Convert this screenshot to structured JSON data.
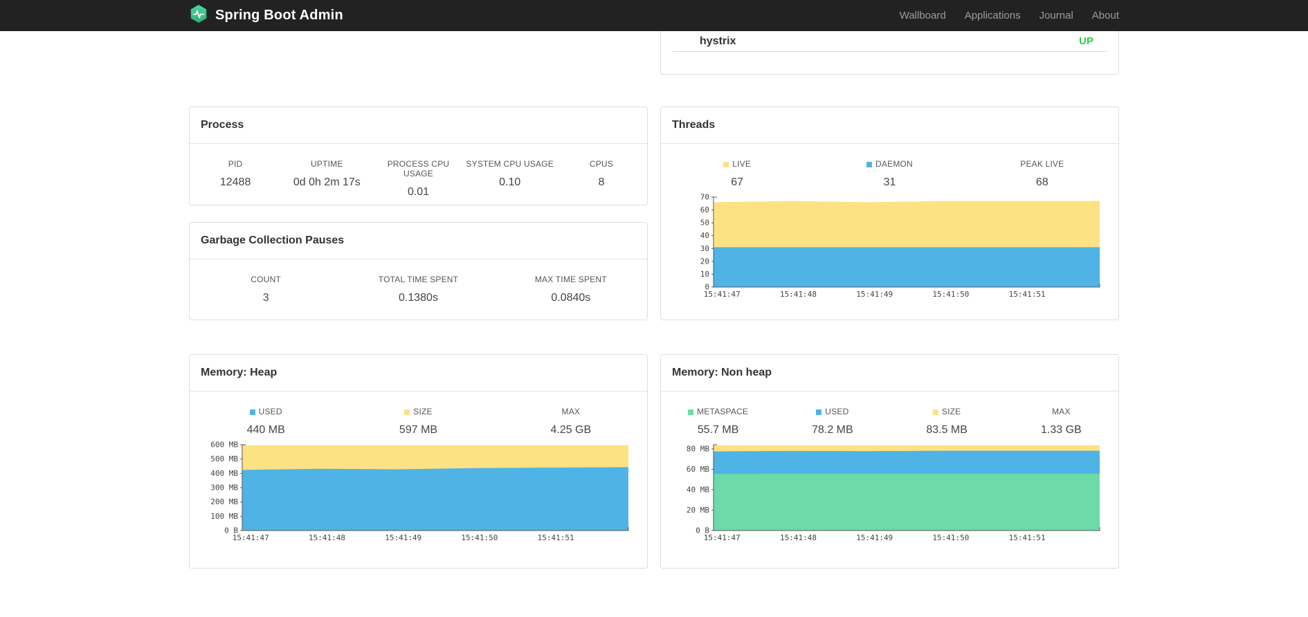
{
  "navbar": {
    "brand": "Spring Boot Admin",
    "links": [
      {
        "label": "Wallboard"
      },
      {
        "label": "Applications"
      },
      {
        "label": "Journal"
      },
      {
        "label": "About"
      }
    ]
  },
  "colors": {
    "accent_green": "#3BC995",
    "status_up": "#2ECC40",
    "series_yellow": "#FCE283",
    "series_blue": "#4FB3E6",
    "series_green": "#6CDAA9"
  },
  "application": {
    "name": "hystrix",
    "status": "UP"
  },
  "process": {
    "title": "Process",
    "metrics": [
      {
        "label": "PID",
        "value": "12488"
      },
      {
        "label": "UPTIME",
        "value": "0d 0h 2m 17s"
      },
      {
        "label": "PROCESS CPU USAGE",
        "value": "0.01"
      },
      {
        "label": "SYSTEM CPU USAGE",
        "value": "0.10"
      },
      {
        "label": "CPUS",
        "value": "8"
      }
    ]
  },
  "gc": {
    "title": "Garbage Collection Pauses",
    "metrics": [
      {
        "label": "COUNT",
        "value": "3"
      },
      {
        "label": "TOTAL TIME SPENT",
        "value": "0.1380s"
      },
      {
        "label": "MAX TIME SPENT",
        "value": "0.0840s"
      }
    ]
  },
  "threads": {
    "title": "Threads",
    "legend": [
      {
        "label": "LIVE",
        "value": "67",
        "swatch": "#FCE283"
      },
      {
        "label": "DAEMON",
        "value": "31",
        "swatch": "#4FB3E6"
      },
      {
        "label": "PEAK LIVE",
        "value": "68"
      }
    ]
  },
  "memory_heap": {
    "title": "Memory: Heap",
    "legend": [
      {
        "label": "USED",
        "value": "440 MB",
        "swatch": "#4FB3E6"
      },
      {
        "label": "SIZE",
        "value": "597 MB",
        "swatch": "#FCE283"
      },
      {
        "label": "MAX",
        "value": "4.25 GB"
      }
    ]
  },
  "memory_nonheap": {
    "title": "Memory: Non heap",
    "legend": [
      {
        "label": "METASPACE",
        "value": "55.7 MB",
        "swatch": "#6CDAA9"
      },
      {
        "label": "USED",
        "value": "78.2 MB",
        "swatch": "#4FB3E6"
      },
      {
        "label": "SIZE",
        "value": "83.5 MB",
        "swatch": "#FCE283"
      },
      {
        "label": "MAX",
        "value": "1.33 GB"
      }
    ]
  },
  "chart_data": [
    {
      "id": "threads",
      "type": "area",
      "title": "Threads",
      "ylim": [
        0,
        70
      ],
      "x_ticks": [
        "15:41:47",
        "15:41:48",
        "15:41:49",
        "15:41:50",
        "15:41:51"
      ],
      "y_ticks": [
        {
          "v": 0,
          "label": "0"
        },
        {
          "v": 10,
          "label": "10"
        },
        {
          "v": 20,
          "label": "20"
        },
        {
          "v": 30,
          "label": "30"
        },
        {
          "v": 40,
          "label": "40"
        },
        {
          "v": 50,
          "label": "50"
        },
        {
          "v": 60,
          "label": "60"
        },
        {
          "v": 70,
          "label": "70"
        }
      ],
      "series": [
        {
          "name": "LIVE",
          "color": "#FCE283",
          "values": [
            66,
            67,
            66,
            67,
            67,
            67
          ]
        },
        {
          "name": "DAEMON",
          "color": "#4FB3E6",
          "values": [
            31,
            31,
            31,
            31,
            31,
            31
          ]
        }
      ]
    },
    {
      "id": "memory-heap",
      "type": "area",
      "title": "Memory: Heap",
      "ylim": [
        0,
        600
      ],
      "x_ticks": [
        "15:41:47",
        "15:41:48",
        "15:41:49",
        "15:41:50",
        "15:41:51"
      ],
      "y_ticks": [
        {
          "v": 0,
          "label": "0 B"
        },
        {
          "v": 100,
          "label": "100 MB"
        },
        {
          "v": 200,
          "label": "200 MB"
        },
        {
          "v": 300,
          "label": "300 MB"
        },
        {
          "v": 400,
          "label": "400 MB"
        },
        {
          "v": 500,
          "label": "500 MB"
        },
        {
          "v": 600,
          "label": "600 MB"
        }
      ],
      "series": [
        {
          "name": "SIZE",
          "color": "#FCE283",
          "values": [
            597,
            597,
            597,
            597,
            597,
            597
          ]
        },
        {
          "name": "USED",
          "color": "#4FB3E6",
          "values": [
            424,
            432,
            428,
            437,
            440,
            443
          ]
        }
      ]
    },
    {
      "id": "memory-nonheap",
      "type": "area",
      "title": "Memory: Non heap",
      "ylim": [
        0,
        84
      ],
      "x_ticks": [
        "15:41:47",
        "15:41:48",
        "15:41:49",
        "15:41:50",
        "15:41:51"
      ],
      "y_ticks": [
        {
          "v": 0,
          "label": "0 B"
        },
        {
          "v": 20,
          "label": "20 MB"
        },
        {
          "v": 40,
          "label": "40 MB"
        },
        {
          "v": 60,
          "label": "60 MB"
        },
        {
          "v": 80,
          "label": "80 MB"
        }
      ],
      "series": [
        {
          "name": "SIZE",
          "color": "#FCE283",
          "values": [
            83.5,
            83.5,
            83.5,
            83.5,
            83.5,
            83.5
          ]
        },
        {
          "name": "USED",
          "color": "#4FB3E6",
          "values": [
            77.5,
            78,
            77.8,
            78.2,
            78.2,
            78.2
          ]
        },
        {
          "name": "METASPACE",
          "color": "#6CDAA9",
          "values": [
            55.5,
            55.7,
            55.6,
            55.7,
            55.7,
            55.7
          ]
        }
      ]
    }
  ]
}
